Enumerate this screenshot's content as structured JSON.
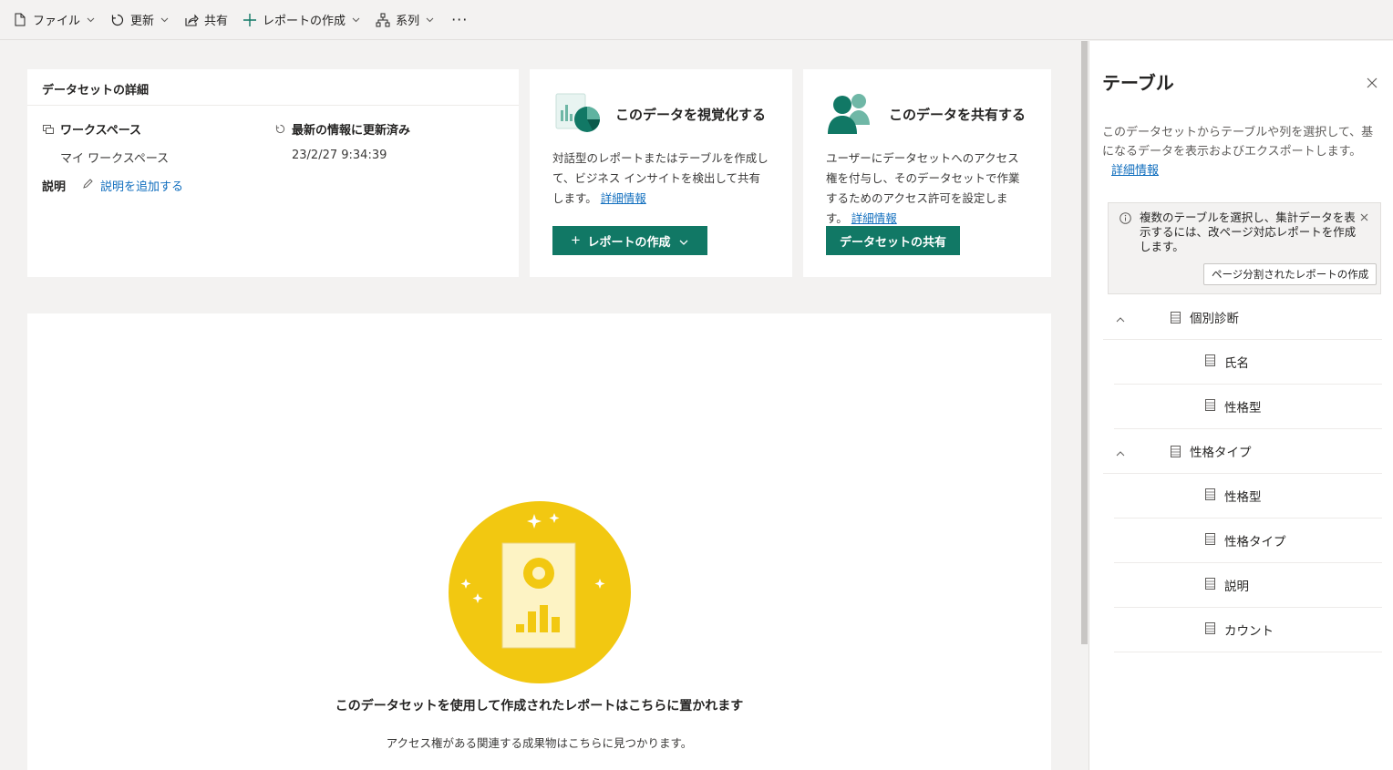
{
  "toolbar": {
    "file": "ファイル",
    "refresh": "更新",
    "share": "共有",
    "create_report": "レポートの作成",
    "lineage": "系列",
    "more": "···"
  },
  "details": {
    "header": "データセットの詳細",
    "workspace_label": "ワークスペース",
    "workspace_value": "マイ ワークスペース",
    "refreshed_label": "最新の情報に更新済み",
    "refreshed_value": "23/2/27 9:34:39",
    "description_label": "説明",
    "add_description": "説明を追加する"
  },
  "visualize": {
    "title": "このデータを視覚化する",
    "body": "対話型のレポートまたはテーブルを作成して、ビジネス インサイトを検出して共有します。",
    "link": "詳細情報",
    "button": "レポートの作成"
  },
  "share": {
    "title": "このデータを共有する",
    "body": "ユーザーにデータセットへのアクセス権を付与し、そのデータセットで作業するためのアクセス許可を設定します。",
    "link": "詳細情報",
    "button": "データセットの共有"
  },
  "reports": {
    "title": "このデータセットを使用して作成されたレポートはこちらに置かれます",
    "subtitle": "アクセス権がある関連する成果物はこちらに見つかります。"
  },
  "panel": {
    "title": "テーブル",
    "description": "このデータセットからテーブルや列を選択して、基になるデータを表示およびエクスポートします。",
    "link": "詳細情報",
    "info_text": "複数のテーブルを選択し、集計データを表示するには、改ページ対応レポートを作成します。",
    "info_button": "ページ分割されたレポートの作成",
    "tables": [
      {
        "name": "個別診断",
        "columns": [
          "氏名",
          "性格型"
        ]
      },
      {
        "name": "性格タイプ",
        "columns": [
          "性格型",
          "性格タイプ",
          "説明",
          "カウント"
        ]
      }
    ]
  },
  "colors": {
    "accent": "#117865",
    "link": "#106ebe",
    "illustration_yellow": "#f2c811"
  },
  "icons": [
    "file-icon",
    "refresh-icon",
    "share-icon",
    "plus-icon",
    "lineage-icon",
    "more-icon",
    "workspace-icon",
    "refresh-small-icon",
    "pencil-icon",
    "chevron-down-icon",
    "close-icon",
    "info-icon",
    "table-icon",
    "caret-up-icon"
  ]
}
